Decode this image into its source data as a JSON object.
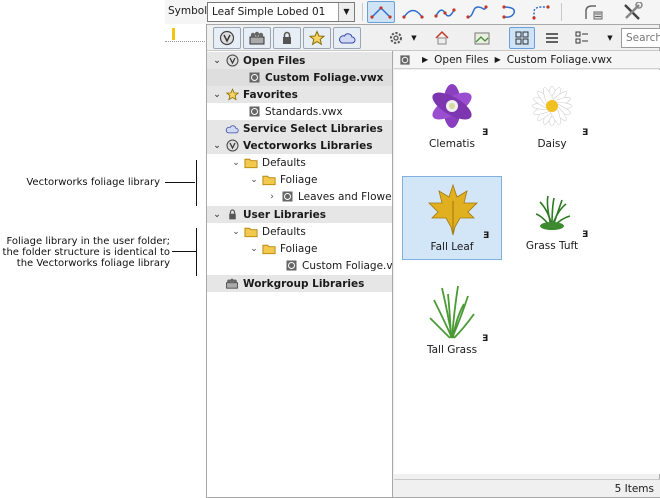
{
  "top_toolbar": {
    "symbol_label": "Symbol",
    "symbol_value": "Leaf Simple Lobed 01"
  },
  "rm_toolbar": {
    "search_placeholder": "Search"
  },
  "tree": [
    {
      "label": "Open Files",
      "bold": true
    },
    {
      "label": "Custom Foliage.vwx",
      "bold": true
    },
    {
      "label": "Favorites",
      "bold": true
    },
    {
      "label": "Standards.vwx",
      "bold": false
    },
    {
      "label": "Service Select Libraries",
      "bold": true
    },
    {
      "label": "Vectorworks Libraries",
      "bold": true
    },
    {
      "label": "Defaults",
      "bold": false
    },
    {
      "label": "Foliage",
      "bold": false
    },
    {
      "label": "Leaves and Flowers",
      "bold": false
    },
    {
      "label": "User Libraries",
      "bold": true
    },
    {
      "label": "Defaults",
      "bold": false
    },
    {
      "label": "Foliage",
      "bold": false
    },
    {
      "label": "Custom Foliage.vwx",
      "bold": false
    },
    {
      "label": "Workgroup Libraries",
      "bold": true
    }
  ],
  "breadcrumb": {
    "root": "Open Files",
    "file": "Custom Foliage.vwx"
  },
  "items": [
    {
      "label": "Clematis",
      "badge": "Ǝ"
    },
    {
      "label": "Daisy",
      "badge": "Ǝ"
    },
    {
      "label": "Fall Leaf",
      "badge": "Ǝ"
    },
    {
      "label": "Grass Tuft",
      "badge": "Ǝ"
    },
    {
      "label": "Tall Grass",
      "badge": "Ǝ"
    }
  ],
  "status": "5 Items",
  "callouts": {
    "vw_library": "Vectorworks foliage library",
    "user_library_1": "Foliage library in the user folder;",
    "user_library_2": "the folder structure is identical to",
    "user_library_3": "the Vectorworks foliage library"
  },
  "colors": {
    "selection": "#d3e6f8",
    "folder": "#f2c94c",
    "accent": "#2e6fd0"
  }
}
